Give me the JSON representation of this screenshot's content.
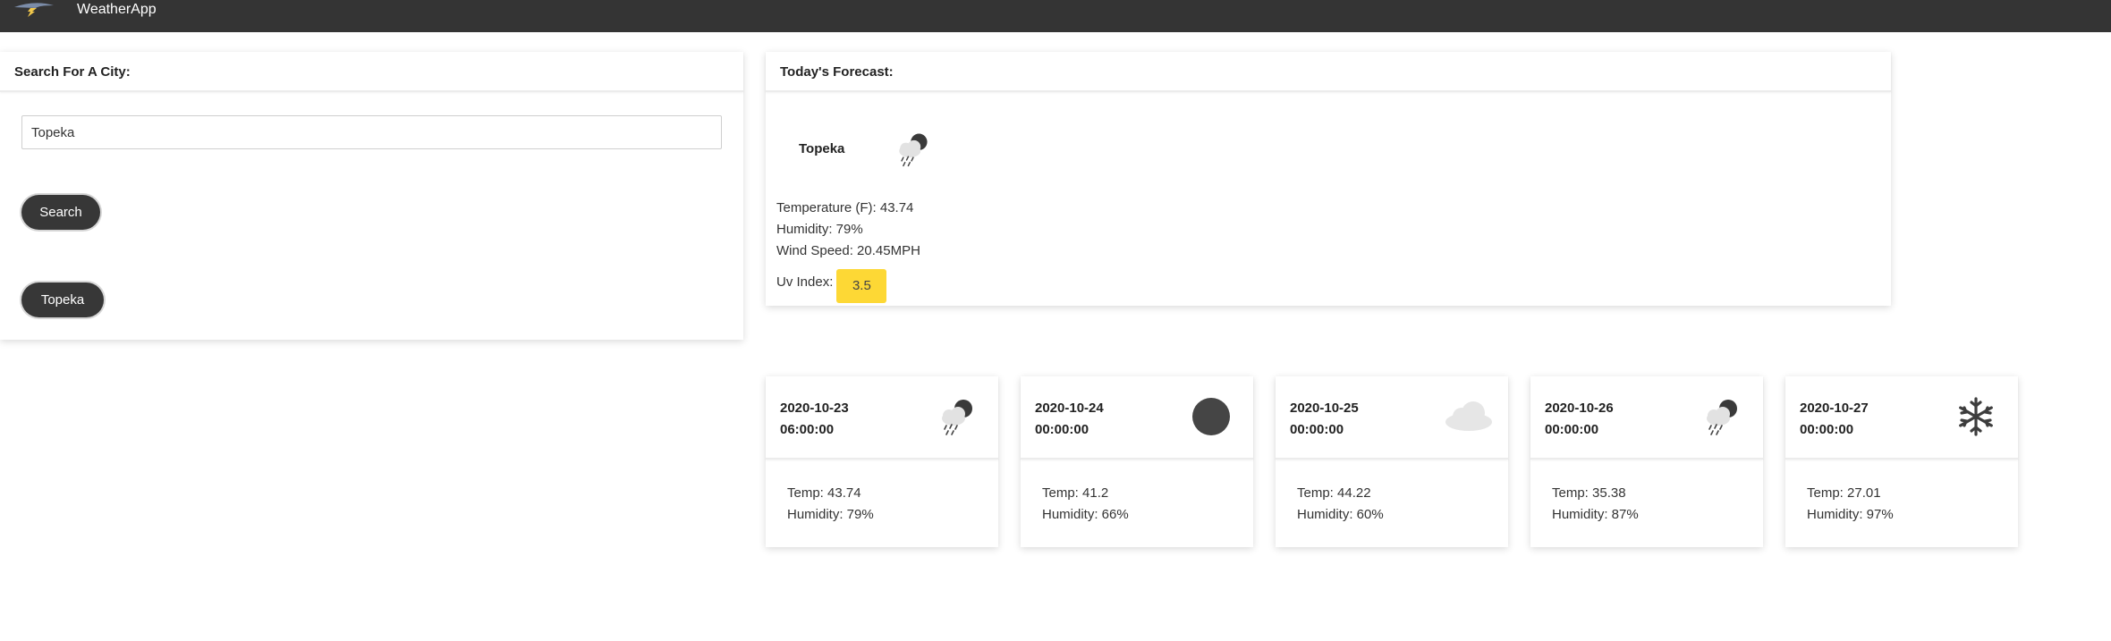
{
  "app": {
    "title": "WeatherApp",
    "logo_icon": "lightning-logo-icon"
  },
  "search": {
    "header": "Search For A City:",
    "input_value": "Topeka",
    "button_label": "Search",
    "history": [
      "Topeka"
    ]
  },
  "today": {
    "header": "Today's Forecast:",
    "city": "Topeka",
    "icon": "rain-cloud-moon-icon",
    "temperature": "Temperature (F): 43.74",
    "humidity": "Humidity: 79%",
    "wind": "Wind Speed: 20.45MPH",
    "uv_label": "Uv Index:",
    "uv_value": "3.5",
    "uv_color": "#fdd835"
  },
  "forecast": [
    {
      "date": "2020-10-23",
      "time": "06:00:00",
      "icon": "rain-cloud-moon-icon",
      "temp": "Temp: 43.74",
      "humidity": "Humidity: 79%"
    },
    {
      "date": "2020-10-24",
      "time": "00:00:00",
      "icon": "moon-icon",
      "temp": "Temp: 41.2",
      "humidity": "Humidity: 66%"
    },
    {
      "date": "2020-10-25",
      "time": "00:00:00",
      "icon": "cloud-icon",
      "temp": "Temp: 44.22",
      "humidity": "Humidity: 60%"
    },
    {
      "date": "2020-10-26",
      "time": "00:00:00",
      "icon": "rain-cloud-moon-icon",
      "temp": "Temp: 35.38",
      "humidity": "Humidity: 87%"
    },
    {
      "date": "2020-10-27",
      "time": "00:00:00",
      "icon": "snowflake-icon",
      "temp": "Temp: 27.01",
      "humidity": "Humidity: 97%"
    }
  ],
  "colors": {
    "navbar": "#343434",
    "button": "#373737",
    "uv_badge": "#fdd835"
  }
}
